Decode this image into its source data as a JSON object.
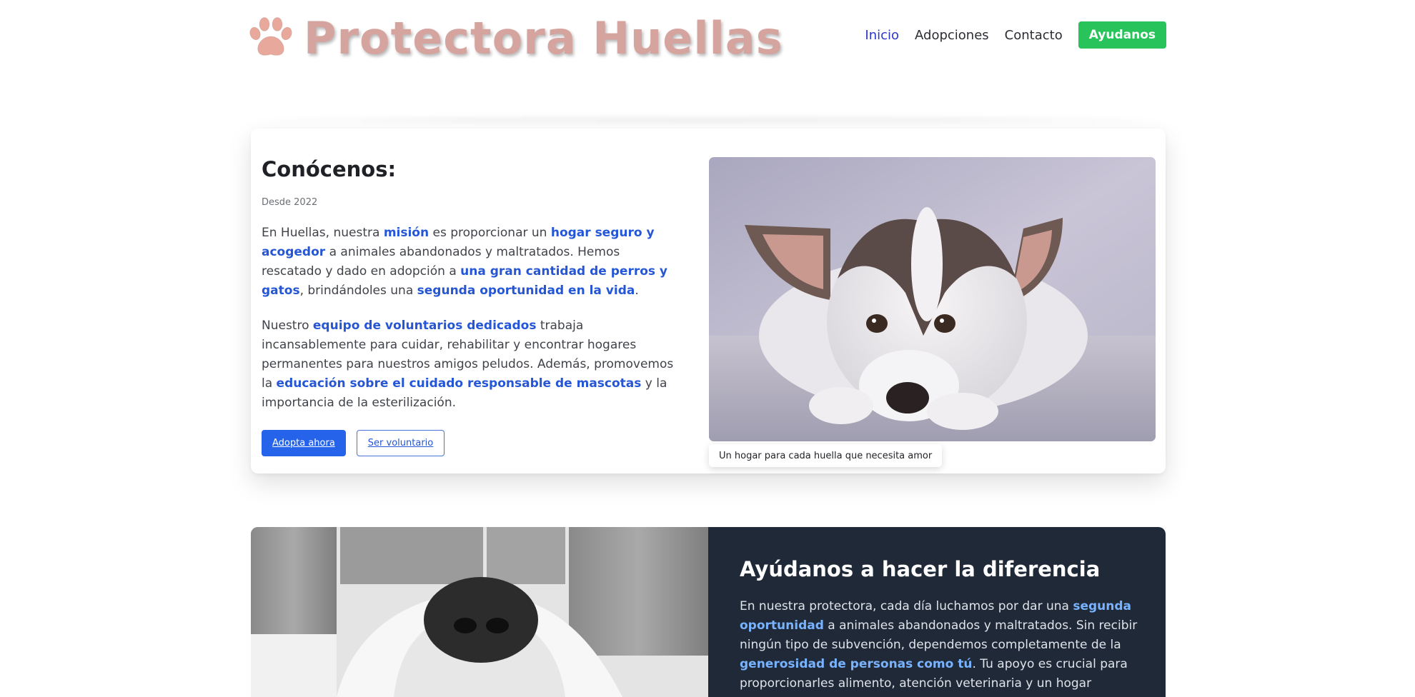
{
  "header": {
    "logo_text": "Protectora Huellas",
    "logo_icon": "paw-icon",
    "nav": [
      {
        "label": "Inicio",
        "active": true
      },
      {
        "label": "Adopciones",
        "active": false
      },
      {
        "label": "Contacto",
        "active": false
      }
    ],
    "cta_label": "Ayudanos"
  },
  "about": {
    "title": "Conócenos:",
    "since": "Desde 2022",
    "p1": {
      "t1": "En Huellas, nuestra ",
      "h1": "misión",
      "t2": " es proporcionar un ",
      "h2": "hogar seguro y acogedor",
      "t3": " a animales abandonados y maltratados. Hemos rescatado y dado en adopción a ",
      "h3": "una gran cantidad de perros y gatos",
      "t4": ", brindándoles una ",
      "h4": "segunda oportunidad en la vida",
      "t5": "."
    },
    "p2": {
      "t1": "Nuestro ",
      "h1": "equipo de voluntarios dedicados",
      "t2": " trabaja incansablemente para cuidar, rehabilitar y encontrar hogares permanentes para nuestros amigos peludos. Además, promovemos la ",
      "h2": "educación sobre el cuidado responsable de mascotas",
      "t3": " y la importancia de la esterilización."
    },
    "btn_adopt": "Adopta ahora",
    "btn_volunteer": "Ser voluntario",
    "caption": "Un hogar para cada huella que necesita amor"
  },
  "help": {
    "title": "Ayúdanos a hacer la diferencia",
    "p": {
      "t1": "En nuestra protectora, cada día luchamos por dar una ",
      "h1": "segunda oportunidad",
      "t2": " a animales abandonados y maltratados. Sin recibir ningún tipo de subvención, dependemos completamente de la ",
      "h2": "generosidad de personas como tú",
      "t3": ". Tu apoyo es crucial para proporcionarles alimento, atención veterinaria y un hogar temporal mientras encuentran una"
    }
  },
  "colors": {
    "accent_blue": "#2563eb",
    "cta_green": "#28c35a",
    "logo_pink": "#d6a49e",
    "dark_section": "#1f2937"
  }
}
